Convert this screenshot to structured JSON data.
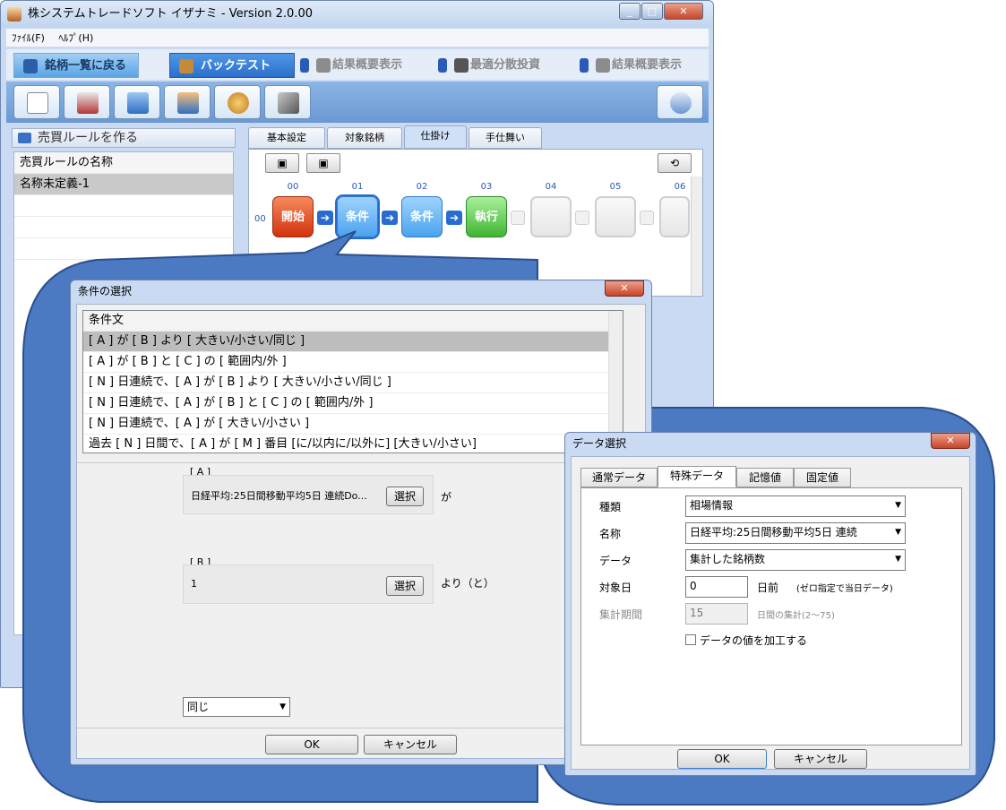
{
  "app": {
    "title": "株システムトレードソフト イザナミ - Version 2.0.00",
    "caption_buttons": [
      "_",
      "□",
      "✕"
    ]
  },
  "menu": [
    "ﾌｧｲﾙ(F)",
    "ﾍﾙﾌﾟ(H)"
  ],
  "nav": {
    "back_label": "銘柄一覧に戻る",
    "active_label": "バックテスト",
    "steps": [
      "結果概要表示",
      "最適分散投資",
      "結果概要表示"
    ]
  },
  "toolbar_icons": [
    "new-file-icon",
    "print-icon",
    "import-icon",
    "export-icon",
    "palette-icon",
    "tools-icon"
  ],
  "left_panel": {
    "title": "売買ルールを作る",
    "column_header": "売買ルールの名称",
    "items": [
      "名称未定義-1"
    ]
  },
  "sub_tabs": [
    "基本設定",
    "対象銘柄",
    "仕掛け",
    "手仕舞い"
  ],
  "flow": {
    "columns": [
      "00",
      "01",
      "02",
      "03",
      "04",
      "05",
      "06"
    ],
    "row_label": "00",
    "nodes": [
      "開始",
      "条件",
      "条件",
      "執行"
    ]
  },
  "cond_dialog": {
    "title": "条件の選択",
    "list_header": "条件文",
    "conditions": [
      "[ A ] が [ B ] より [ 大きい/小さい/同じ ]",
      "[ A ] が [ B ] と [ C ] の [ 範囲内/外 ]",
      "[ N ] 日連続で、[ A ] が [ B ] より [ 大きい/小さい/同じ ]",
      "[ N ] 日連続で、[ A ] が [ B ] と [ C ] の [ 範囲内/外 ]",
      "[ N ] 日連続で、[ A ] が [ 大きい/小さい ]",
      "過去 [ N ] 日間で、[ A ] が [ M ] 番目 [に/以内に/以外に] [大きい/小さい]"
    ],
    "group_a": {
      "label": "[ A ]",
      "value": "日経平均:25日間移動平均5日 連続Do...",
      "select_label": "選択",
      "suffix": "が"
    },
    "group_b": {
      "label": "[ B ]",
      "value": "1",
      "select_label": "選択",
      "suffix": "より（と）"
    },
    "compare_value": "同じ",
    "ok": "OK",
    "cancel": "キャンセル"
  },
  "data_dialog": {
    "title": "データ選択",
    "tabs": [
      "通常データ",
      "特殊データ",
      "記憶値",
      "固定値"
    ],
    "fields": {
      "kind_label": "種類",
      "kind_value": "相場情報",
      "name_label": "名称",
      "name_value": "日経平均:25日間移動平均5日 連続",
      "data_label": "データ",
      "data_value": "集計した銘柄数",
      "day_label": "対象日",
      "day_value": "0",
      "day_suffix": "日前",
      "day_note": "(ゼロ指定で当日データ)",
      "period_label": "集計期間",
      "period_value": "15",
      "period_suffix": "日間の集計(2〜75)"
    },
    "checkbox_label": "データの値を加工する",
    "ok": "OK",
    "cancel": "キャンセル"
  }
}
